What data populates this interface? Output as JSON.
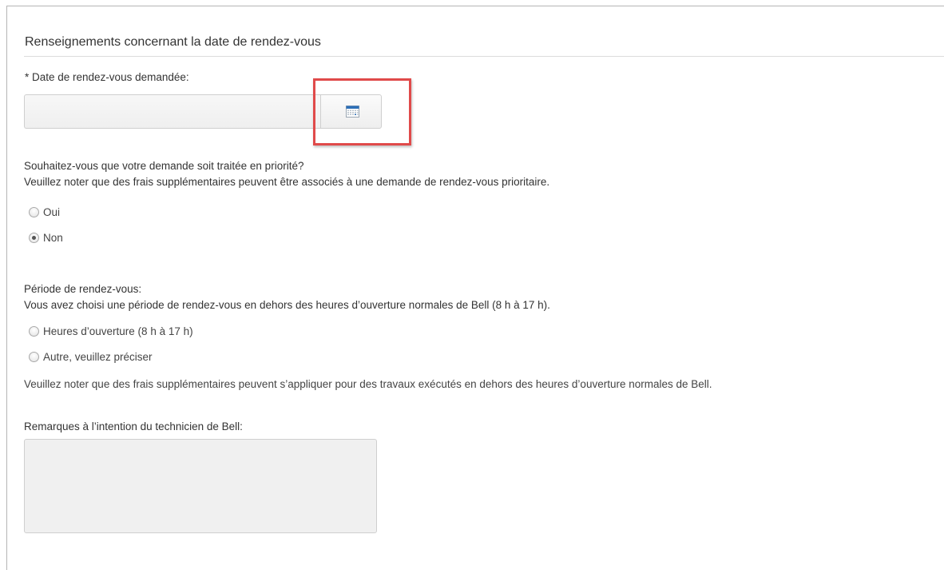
{
  "section": {
    "title": "Renseignements concernant la date de rendez-vous"
  },
  "date_field": {
    "label": "* Date de rendez-vous demandée:",
    "value": "",
    "button_icon": "calendar-icon"
  },
  "priority": {
    "question": "Souhaitez-vous que votre demande soit traitée en priorité?",
    "note": "Veuillez noter que des frais supplémentaires peuvent être associés à une demande de rendez-vous prioritaire.",
    "options": [
      {
        "label": "Oui",
        "checked": false
      },
      {
        "label": "Non",
        "checked": true
      }
    ]
  },
  "period": {
    "label": "Période de rendez-vous:",
    "info": "Vous avez choisi une période de rendez-vous en dehors des heures d’ouverture normales de Bell (8 h à 17 h).",
    "options": [
      {
        "label": "Heures d’ouverture (8 h à 17 h)",
        "checked": false
      },
      {
        "label": "Autre, veuillez préciser",
        "checked": false
      }
    ],
    "fee_note": "Veuillez noter que des frais supplémentaires peuvent s’appliquer pour des travaux exécutés en dehors des heures d’ouverture normales de Bell."
  },
  "remarks": {
    "label": "Remarques à l’intention du technicien de Bell:",
    "value": ""
  },
  "colors": {
    "highlight": "#e04a4a",
    "calendar_header": "#2d6fb7"
  }
}
